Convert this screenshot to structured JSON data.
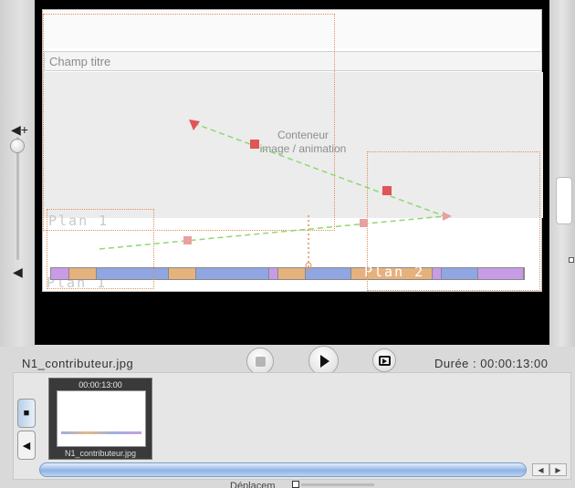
{
  "stage": {
    "field_title": "Champ titre",
    "container_label_line1": "Conteneur",
    "container_label_line2": "image / animation",
    "plan_a": "Plan 1",
    "plan_b": "Plan 1",
    "plan_c": "Plan 2"
  },
  "timeline_segments": [
    {
      "color": "#c89be6",
      "w": 20
    },
    {
      "color": "#e5b27e",
      "w": 30
    },
    {
      "color": "#8fa6e2",
      "w": 80
    },
    {
      "color": "#e5b27e",
      "w": 30
    },
    {
      "color": "#8fa6e2",
      "w": 80
    },
    {
      "color": "#c89be6",
      "w": 10
    },
    {
      "color": "#e5b27e",
      "w": 30
    },
    {
      "color": "#8fa6e2",
      "w": 50
    },
    {
      "color": "#e5b27e",
      "w": 90
    },
    {
      "color": "#c89be6",
      "w": 10
    },
    {
      "color": "#8fa6e2",
      "w": 40
    },
    {
      "color": "#c89be6",
      "w": 50
    }
  ],
  "player": {
    "filename": "N1_contributeur.jpg",
    "duration": "Durée : 00:00:13:00"
  },
  "bin": {
    "clip_time": "00:00:13:00",
    "clip_name": "N1_contributeur.jpg"
  },
  "footer": {
    "move_label": "Déplacem"
  },
  "icons": {
    "volume_high": "speaker-high-icon",
    "volume_low": "speaker-low-icon"
  },
  "colors": {
    "path_green": "#8fd870",
    "marker_red": "#e05555",
    "dotted_orange": "#e0915a"
  }
}
